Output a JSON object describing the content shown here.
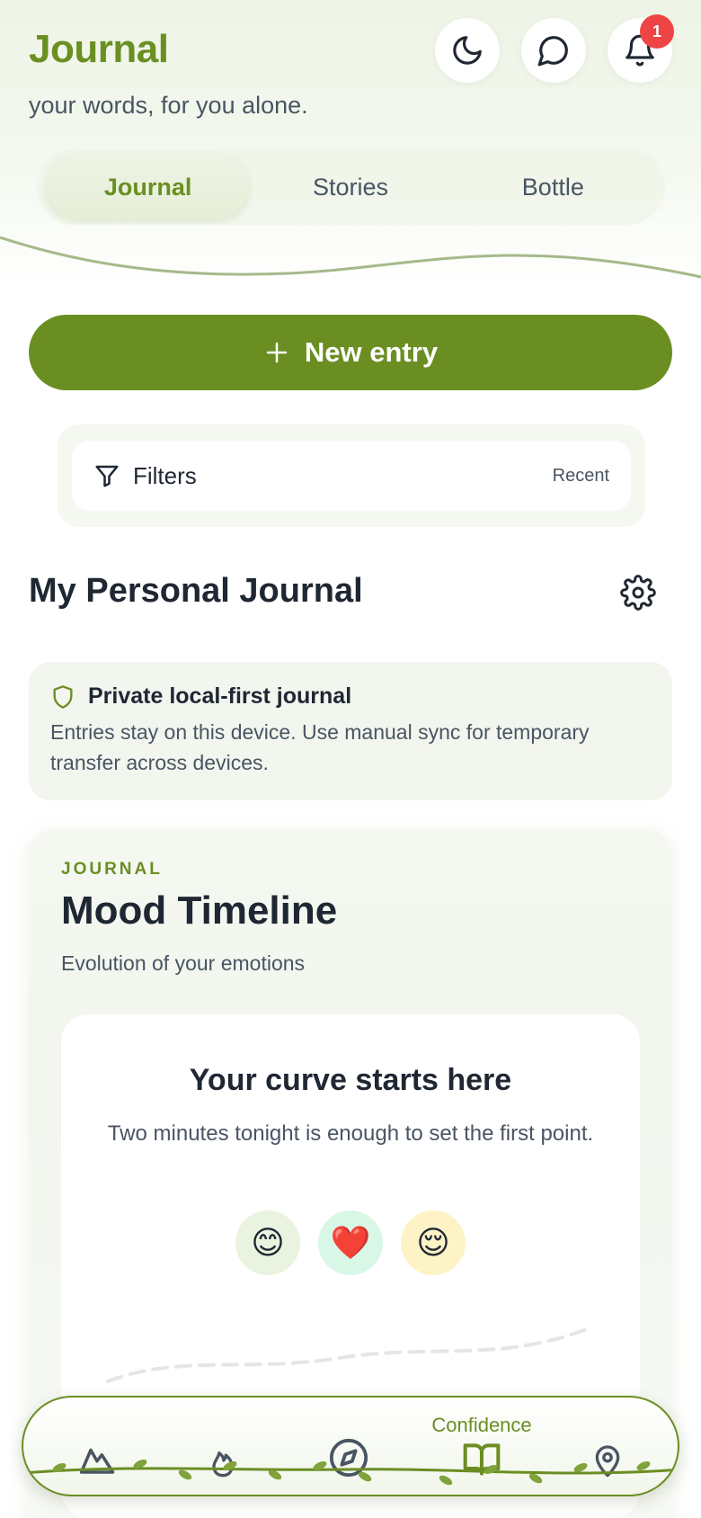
{
  "header": {
    "title": "Journal",
    "subtitle": "your words, for you alone.",
    "notification_count": "1"
  },
  "tabs": [
    {
      "label": "Journal",
      "active": true
    },
    {
      "label": "Stories",
      "active": false
    },
    {
      "label": "Bottle",
      "active": false
    }
  ],
  "actions": {
    "new_entry_label": "New entry"
  },
  "filters": {
    "label": "Filters",
    "sort": "Recent"
  },
  "section": {
    "title": "My Personal Journal"
  },
  "privacy": {
    "title": "Private local-first journal",
    "text": "Entries stay on this device. Use manual sync for temporary transfer across devices."
  },
  "mood": {
    "eyebrow": "JOURNAL",
    "title": "Mood Timeline",
    "subtitle": "Evolution of your emotions",
    "empty_title": "Your curve starts here",
    "empty_text": "Two minutes tonight is enough to set the first point.",
    "emojis": [
      "😊",
      "❤️",
      "😌"
    ]
  },
  "nav": {
    "active_label": "Confidence"
  },
  "colors": {
    "accent": "#6b8e23",
    "badge": "#ef4444"
  }
}
